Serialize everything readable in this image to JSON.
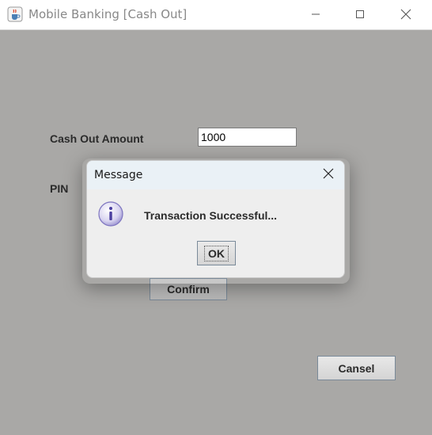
{
  "window": {
    "title": "Mobile Banking [Cash Out]",
    "icon": "java-cup-icon",
    "controls": [
      "minimize-icon",
      "maximize-icon",
      "close-icon"
    ]
  },
  "form": {
    "amount_label": "Cash Out Amount",
    "amount_value": "1000",
    "pin_label": "PIN",
    "confirm_label": "Confirm",
    "cancel_label": "Cansel"
  },
  "dialog": {
    "title": "Message",
    "icon": "info-icon",
    "message": "Transaction Successful...",
    "ok_label": "OK"
  },
  "colors": {
    "window_background": "#a9a8a6",
    "dialog_background": "#eeeeee",
    "dialog_titlebar": "#eaf1f6"
  }
}
